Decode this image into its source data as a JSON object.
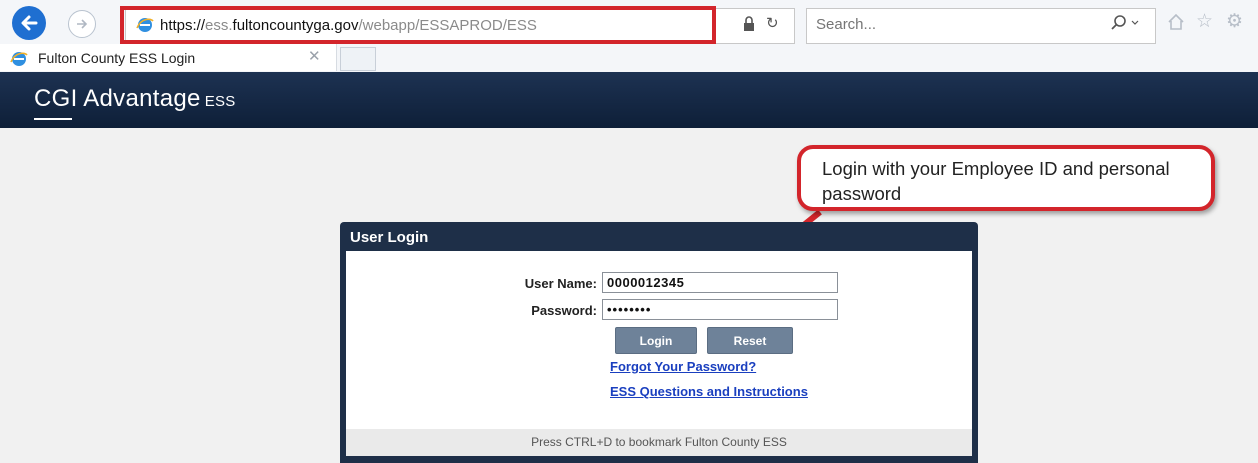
{
  "browser": {
    "url_prefix": "https://",
    "url_subdomain": "ess.",
    "url_domain": "fultoncountyga.gov",
    "url_path": "/webapp/ESSAPROD/ESS",
    "search_placeholder": "Search...",
    "tab_title": "Fulton County ESS Login",
    "highlight_color": "#d3252b"
  },
  "app": {
    "brand": "CGI Advantage",
    "brand_suffix": "ESS"
  },
  "callout": {
    "text": "Login with your Employee ID and personal password"
  },
  "login": {
    "title": "User Login",
    "user_label": "User Name:",
    "user_value": "0000012345",
    "password_label": "Password:",
    "password_value": "••••••••",
    "login_button": "Login",
    "reset_button": "Reset",
    "forgot_link": "Forgot Your Password?",
    "instructions_link": "ESS Questions and Instructions",
    "footer": "Press CTRL+D to bookmark Fulton County ESS"
  },
  "icons": [
    "back-arrow-icon",
    "forward-arrow-icon",
    "ie-logo-icon",
    "lock-icon",
    "refresh-icon",
    "search-icon",
    "home-icon",
    "star-icon",
    "gear-icon",
    "close-icon"
  ]
}
